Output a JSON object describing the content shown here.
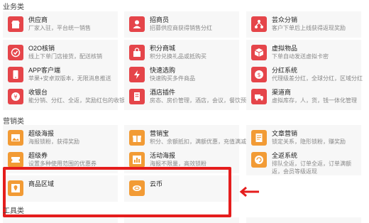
{
  "sections": {
    "business": "业务类",
    "marketing": "营销类",
    "tools": "工具类"
  },
  "cards": {
    "supplier": {
      "name": "供应商",
      "desc": "厂家入驻，平台统一销售"
    },
    "recruiter": {
      "name": "招商员",
      "desc": "招募供应商获得销售分红"
    },
    "multi_dist": {
      "name": "芸众分销",
      "desc": "客户下单后上线获得返现奖励"
    },
    "o2o": {
      "name": "O2O核销",
      "desc": "线上下单门店接货，配送核销"
    },
    "points_mall": {
      "name": "积分商城",
      "desc": "积分兑换礼品或抵购买"
    },
    "virtual": {
      "name": "虚拟物品",
      "desc": "下单自动发送虚拟卡密"
    },
    "app": {
      "name": "APP客户端",
      "desc": "苹果+安卓双版本，无限消息推送"
    },
    "quick_buy": {
      "name": "快速选购",
      "desc": "快速购买多件商品"
    },
    "bonus_system": {
      "name": "分红系统",
      "desc": "代理级差分红，全球分红，区域分红"
    },
    "cashier": {
      "name": "收银台",
      "desc": "能分销、分红、全返，奖励红包的收银台"
    },
    "hotel": {
      "name": "酒店插件",
      "desc": "房态、房价管理，酒店，会议，餐饮预订"
    },
    "channel": {
      "name": "渠道商",
      "desc": "虚拟库存，人，货，钱一体化管理"
    },
    "poster": {
      "name": "超级海报",
      "desc": "海报锁粉，获得奖励"
    },
    "marketing_bao": {
      "name": "营销宝",
      "desc": "积分、余额抵扣，满额优惠，充值满减"
    },
    "article": {
      "name": "文章营销",
      "desc": "锁定关系，隐形锁粉，赚奖励"
    },
    "coupon": {
      "name": "超级券",
      "desc": "设置多种使用范围的优惠券"
    },
    "activity_poster": {
      "name": "活动海报",
      "desc": "海报不限量，高效锁粉"
    },
    "full_return": {
      "name": "全返系统",
      "desc": "排队全返，订单全返，订单满额返，会员等级返现"
    },
    "product_zone": {
      "name": "商品区域",
      "desc": ""
    },
    "cloud_coin": {
      "name": "云币",
      "desc": ""
    }
  },
  "colors": {
    "red": "#e5454a",
    "orange": "#f29b35",
    "highlight": "#e51d1d"
  }
}
